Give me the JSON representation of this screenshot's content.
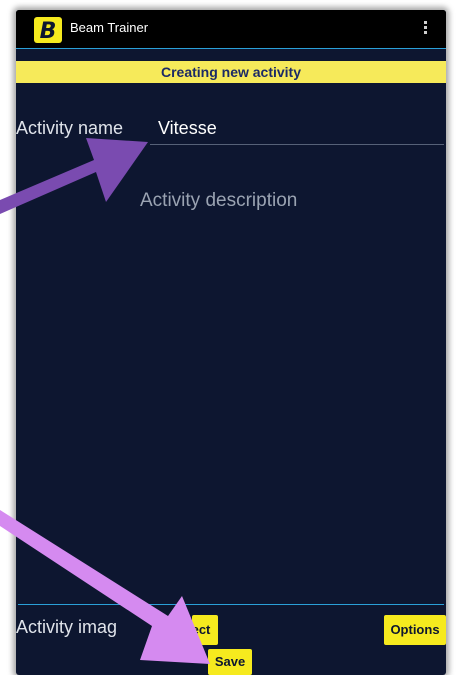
{
  "app": {
    "title": "Beam Trainer",
    "logo_letter": "B"
  },
  "banner": {
    "text": "Creating new activity"
  },
  "form": {
    "activity_name_label": "Activity name",
    "activity_name_value": "Vitesse",
    "activity_description_placeholder": "Activity description",
    "activity_image_label": "Activity imag"
  },
  "buttons": {
    "select_label": "ect",
    "options_label": "Options",
    "save_label": "Save"
  },
  "icons": {
    "menu": "overflow-menu-icon"
  },
  "colors": {
    "background": "#0d1630",
    "accent_yellow": "#f6ea1e",
    "banner_yellow": "#f6ea5a",
    "divider_blue": "#2aa0d8",
    "arrow_dark_purple": "#7a4bb0",
    "arrow_light_purple": "#d58af0"
  }
}
